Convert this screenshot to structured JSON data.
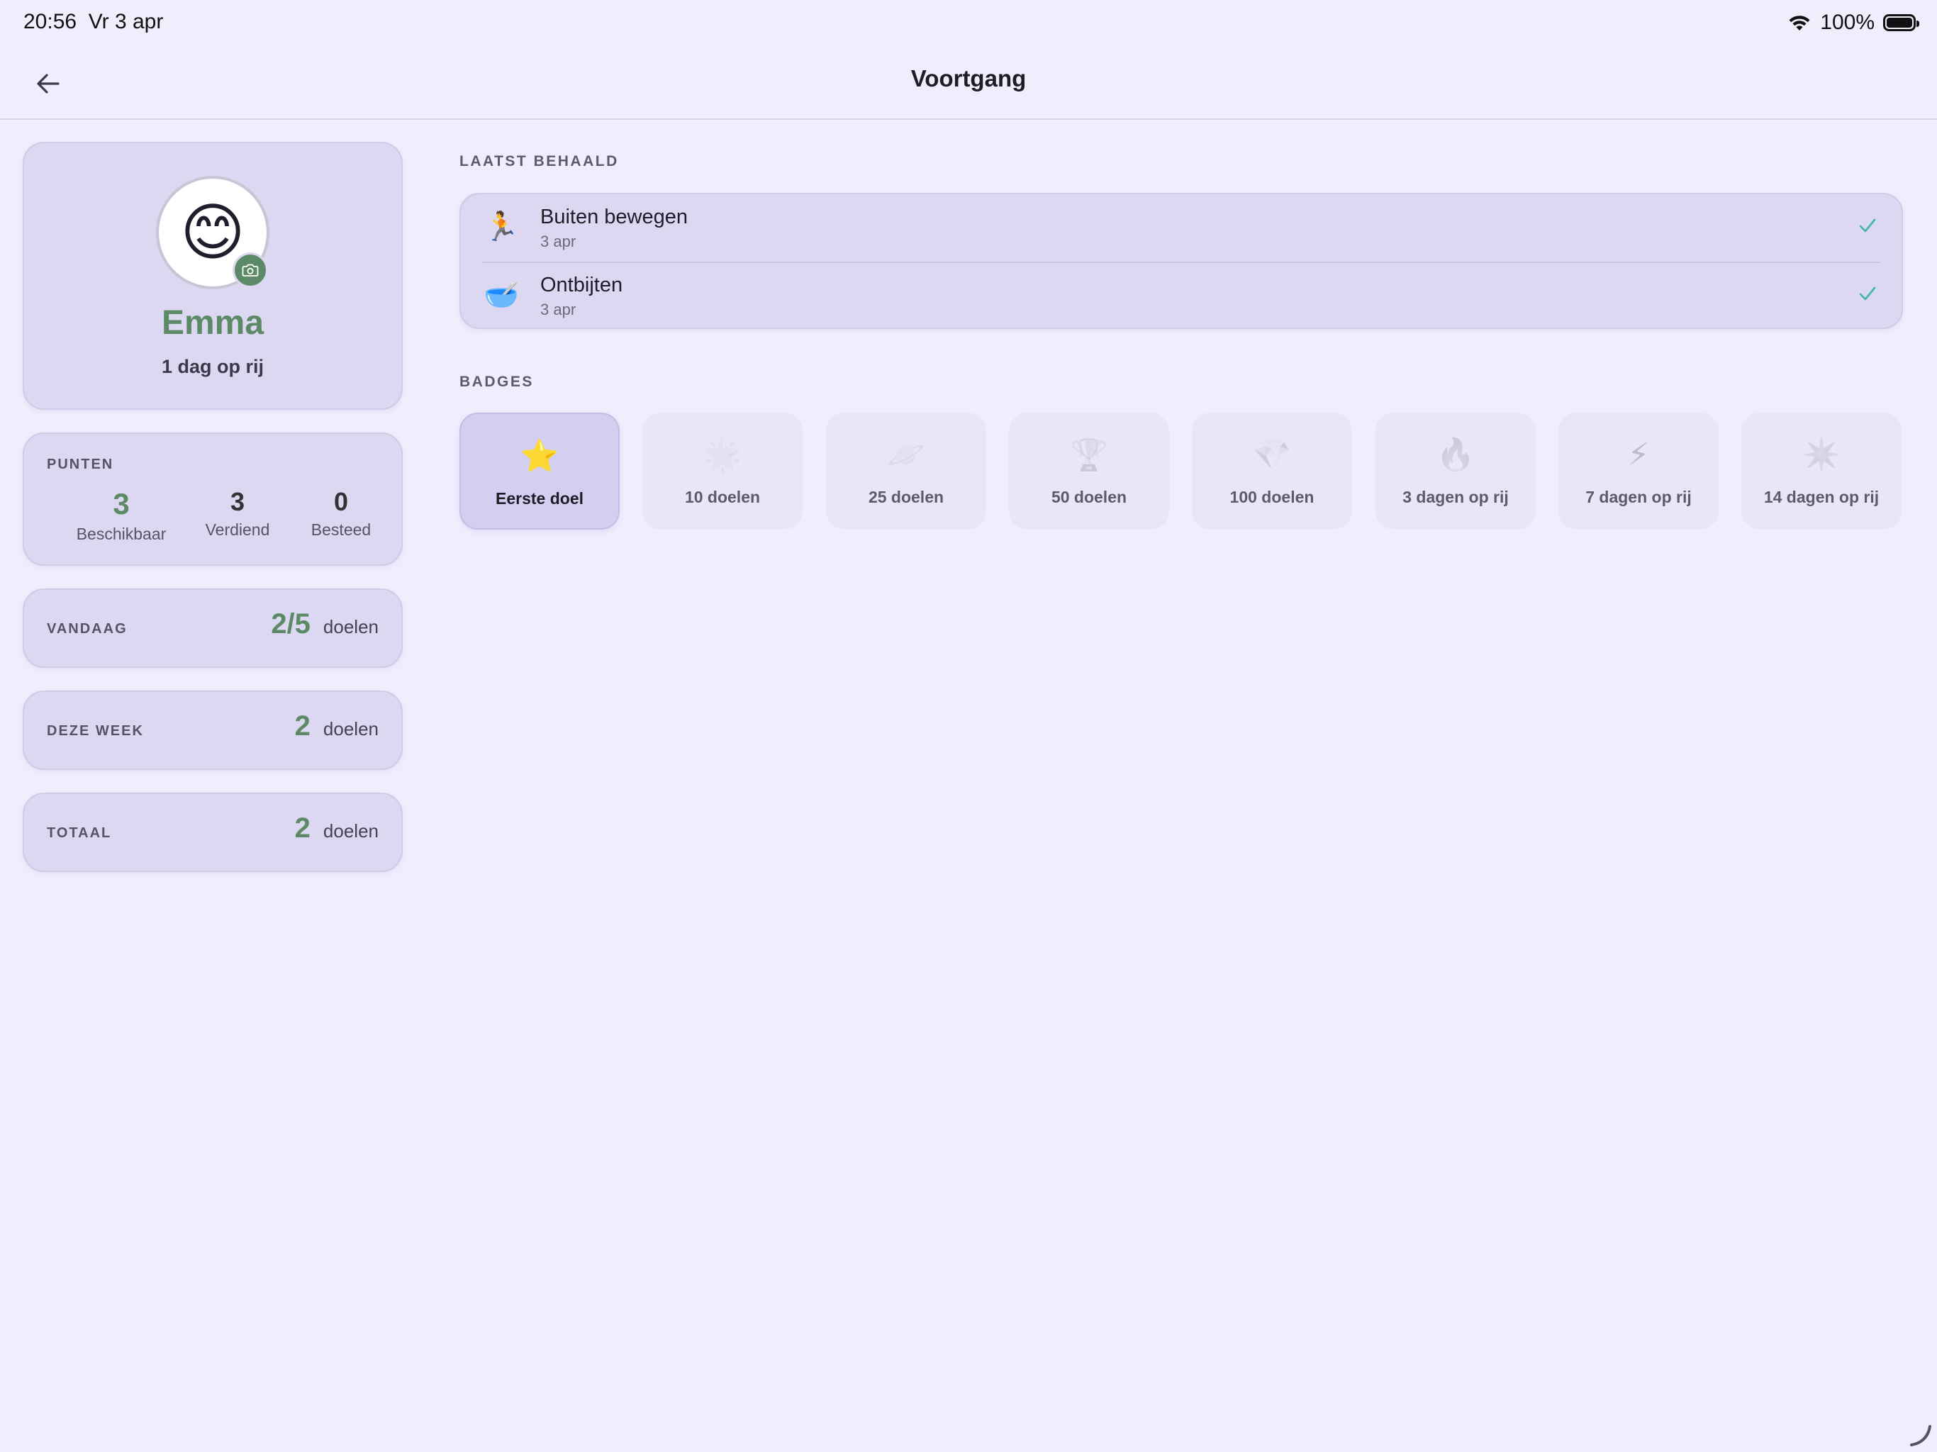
{
  "status_bar": {
    "time": "20:56",
    "date": "Vr 3 apr",
    "battery": "100%"
  },
  "nav": {
    "title": "Voortgang"
  },
  "profile": {
    "avatar_emoji": "😊",
    "name": "Emma",
    "streak": "1 dag op rij"
  },
  "points": {
    "label": "PUNTEN",
    "available": {
      "value": "3",
      "label": "Beschikbaar"
    },
    "earned": {
      "value": "3",
      "label": "Verdiend"
    },
    "spent": {
      "value": "0",
      "label": "Besteed"
    }
  },
  "stats": {
    "today": {
      "label": "VANDAAG",
      "value": "2/5",
      "unit": "doelen"
    },
    "week": {
      "label": "DEZE WEEK",
      "value": "2",
      "unit": "doelen"
    },
    "total": {
      "label": "TOTAAL",
      "value": "2",
      "unit": "doelen"
    }
  },
  "recent": {
    "title": "LAATST BEHAALD",
    "items": [
      {
        "emoji": "🏃",
        "title": "Buiten bewegen",
        "date": "3 apr"
      },
      {
        "emoji": "🥣",
        "title": "Ontbijten",
        "date": "3 apr"
      }
    ]
  },
  "badges": {
    "title": "BADGES",
    "items": [
      {
        "icon": "⭐",
        "label": "Eerste doel"
      },
      {
        "icon": "🌟",
        "label": "10 doelen"
      },
      {
        "icon": "🪐",
        "label": "25 doelen"
      },
      {
        "icon": "🏆",
        "label": "50 doelen"
      },
      {
        "icon": "💎",
        "label": "100 doelen"
      },
      {
        "icon": "🔥",
        "label": "3 dagen op rij"
      },
      {
        "icon": "⚡",
        "label": "7 dagen op rij"
      },
      {
        "icon": "✴️",
        "label": "14 dagen op rij"
      }
    ]
  },
  "colors": {
    "accent": "#5c8a66",
    "check": "#3fb7a8",
    "background": "#f0eefd",
    "card": "#dcd8f1"
  }
}
